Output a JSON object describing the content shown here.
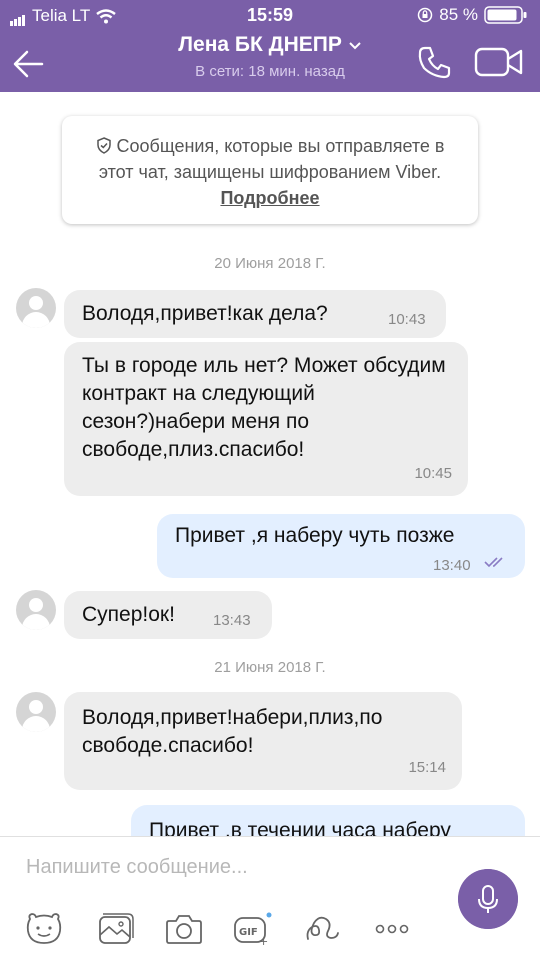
{
  "status_bar": {
    "carrier": "Telia LT",
    "time": "15:59",
    "battery": "85 %"
  },
  "header": {
    "contact_name": "Лена БК ДНЕПР",
    "presence": "В сети: 18 мин. назад"
  },
  "encryption_notice": {
    "text": "Сообщения, которые вы отправляете в этот чат, защищены шифрованием Viber.",
    "link": "Подробнее"
  },
  "dates": [
    "20 Июня 2018 Г.",
    "21 Июня 2018 Г."
  ],
  "messages": [
    {
      "direction": "incoming",
      "text": "Володя,привет!как дела?",
      "time": "10:43"
    },
    {
      "direction": "incoming",
      "text": "Ты в городе иль нет? Может обсудим контракт на следующий сезон?)набери меня по свободе,плиз.спасибо!",
      "time": "10:45"
    },
    {
      "direction": "outgoing",
      "text": "Привет ,я наберу чуть позже",
      "time": "13:40"
    },
    {
      "direction": "incoming",
      "text": "Супер!ок!",
      "time": "13:43"
    },
    {
      "direction": "incoming",
      "text": "Володя,привет!набери,плиз,по свободе.спасибо!",
      "time": "15:14"
    },
    {
      "direction": "outgoing",
      "text": "Привет ,в течении часа наберу",
      "time": ""
    }
  ],
  "composer": {
    "placeholder": "Напишите сообщение..."
  },
  "toolbar_icons": [
    "sticker-icon",
    "gallery-icon",
    "camera-icon",
    "gif-icon",
    "doodle-icon",
    "more-icon"
  ],
  "colors": {
    "brand": "#7a5fa8",
    "incoming_bubble": "#ededed",
    "outgoing_bubble": "#e3efff"
  }
}
